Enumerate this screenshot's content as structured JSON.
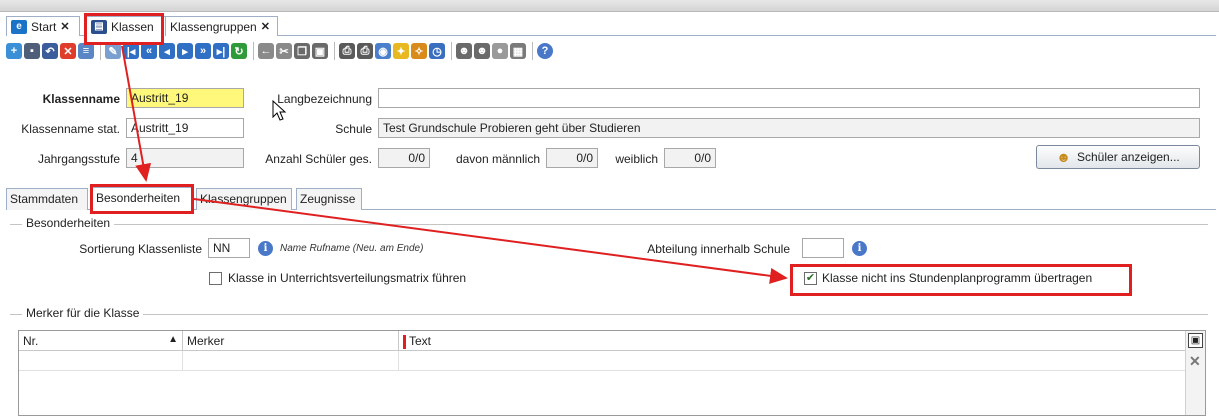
{
  "tabs": [
    {
      "label": "Start",
      "close": "✕",
      "icon": "home-e-icon"
    },
    {
      "label": "Klassen",
      "icon": "class-table-icon"
    },
    {
      "label": "Klassengruppen",
      "close": "✕"
    }
  ],
  "toolbar": {
    "icons": [
      "new-icon",
      "save-icon",
      "undo-icon",
      "delete-icon",
      "list-icon",
      "edit-icon",
      "first-icon",
      "fast-back-icon",
      "back-icon",
      "forward-icon",
      "fast-forward-icon",
      "last-icon",
      "refresh-icon",
      "arrow-left-icon",
      "cut-icon",
      "copy-icon",
      "paste-icon",
      "print-icon",
      "print-preview-icon",
      "view-icon",
      "bulb-icon",
      "clean-icon",
      "timer-icon",
      "users-icon",
      "users2-icon",
      "info-disc-icon",
      "report-icon",
      "help-icon"
    ]
  },
  "header": {
    "klassenname_label": "Klassenname",
    "klassenname_value": "Austritt_19",
    "langbezeichnung_label": "Langbezeichnung",
    "langbezeichnung_value": "",
    "klassenname_stat_label": "Klassenname stat.",
    "klassenname_stat_value": "Austritt_19",
    "schule_label": "Schule",
    "schule_value": "Test Grundschule Probieren geht über Studieren",
    "jahrgangsstufe_label": "Jahrgangsstufe",
    "jahrgangsstufe_value": "4",
    "anzahl_label": "Anzahl Schüler ges.",
    "anzahl_value": "0/0",
    "maennlich_label": "davon männlich",
    "maennlich_value": "0/0",
    "weiblich_label": "weiblich",
    "weiblich_value": "0/0",
    "show_students_button": "Schüler anzeigen..."
  },
  "subtabs": [
    "Stammdaten",
    "Besonderheiten",
    "Klassengruppen",
    "Zeugnisse"
  ],
  "besonderheiten": {
    "group_title": "Besonderheiten",
    "sortierung_label": "Sortierung Klassenliste",
    "sortierung_value": "NN",
    "sortierung_hint": "Name Rufname (Neu. am Ende)",
    "abteilung_label": "Abteilung innerhalb Schule",
    "abteilung_value": "",
    "uvmatrix_label": "Klasse in Unterrichtsverteilungsmatrix führen",
    "uvmatrix_checked": false,
    "stundenplan_label": "Klasse nicht ins Stundenplanprogramm übertragen",
    "stundenplan_checked": true,
    "check_mark": "✔"
  },
  "merker": {
    "group_title": "Merker für die Klasse",
    "columns": [
      "Nr.",
      "Merker",
      "Text"
    ],
    "sort_indicator": "▲",
    "clear_icon": "✕",
    "filter_icon": "▣"
  },
  "colors": {
    "accent_red": "#e02020",
    "highlight_yellow": "#fff87a",
    "tab_blue": "#2b6cc4"
  }
}
